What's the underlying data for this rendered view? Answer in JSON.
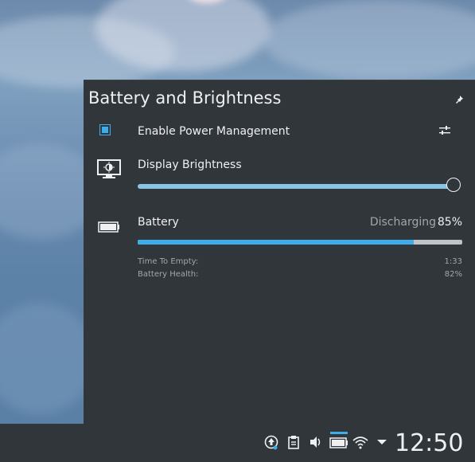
{
  "popup": {
    "title": "Battery and Brightness",
    "power_management": {
      "label": "Enable Power Management",
      "checked": true
    },
    "brightness": {
      "label": "Display Brightness",
      "level": 1.0
    },
    "battery": {
      "label": "Battery",
      "status": "Discharging",
      "percent_text": "85%",
      "charge_level": 0.85,
      "details": [
        {
          "label": "Time To Empty:",
          "value": "1:33"
        },
        {
          "label": "Battery Health:",
          "value": "82%"
        }
      ]
    }
  },
  "taskbar": {
    "clock": "12:50",
    "tray_icons": [
      "updates-icon",
      "clipboard-icon",
      "volume-icon",
      "battery-icon",
      "wifi-icon",
      "expand-tray-icon"
    ]
  },
  "colors": {
    "panel_bg": "#31363b",
    "accent": "#3daee9",
    "text": "#eff0f1",
    "muted_text": "#a3a6a9"
  }
}
